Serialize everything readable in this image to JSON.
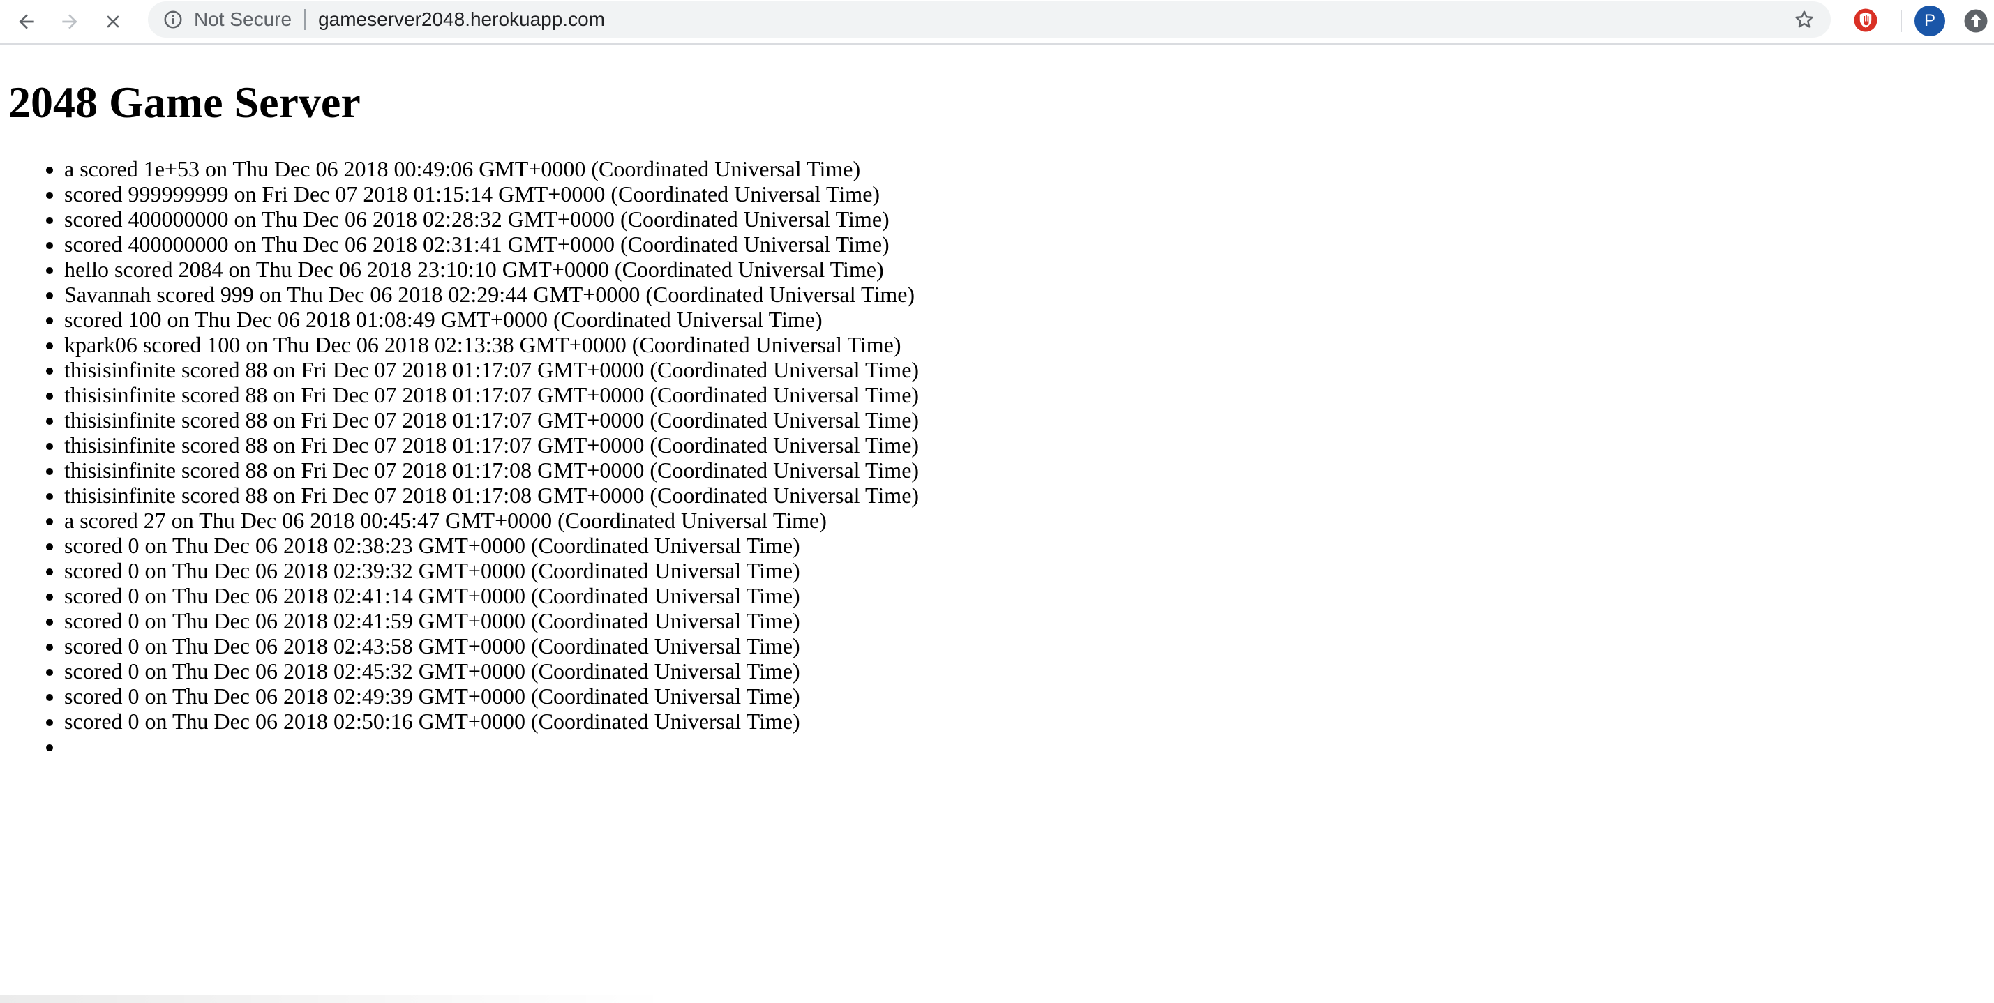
{
  "browser": {
    "security_label": "Not Secure",
    "url": "gameserver2048.herokuapp.com",
    "profile_initial": "P",
    "icons": {
      "back": "arrow-left-icon",
      "forward": "arrow-right-icon",
      "stop": "close-x-icon",
      "info": "info-circle-icon",
      "bookmark": "star-icon",
      "extension": "red-shield-extension-icon",
      "update": "up-arrow-circle-icon"
    },
    "colors": {
      "omnibox_bg": "#f1f3f4",
      "avatar_bg": "#1a56a8",
      "extension": "#d93025"
    }
  },
  "page": {
    "title": "2048 Game Server",
    "scores": [
      "a scored 1e+53 on Thu Dec 06 2018 00:49:06 GMT+0000 (Coordinated Universal Time)",
      "scored 999999999 on Fri Dec 07 2018 01:15:14 GMT+0000 (Coordinated Universal Time)",
      "scored 400000000 on Thu Dec 06 2018 02:28:32 GMT+0000 (Coordinated Universal Time)",
      "scored 400000000 on Thu Dec 06 2018 02:31:41 GMT+0000 (Coordinated Universal Time)",
      "hello scored 2084 on Thu Dec 06 2018 23:10:10 GMT+0000 (Coordinated Universal Time)",
      "Savannah scored 999 on Thu Dec 06 2018 02:29:44 GMT+0000 (Coordinated Universal Time)",
      "scored 100 on Thu Dec 06 2018 01:08:49 GMT+0000 (Coordinated Universal Time)",
      "kpark06 scored 100 on Thu Dec 06 2018 02:13:38 GMT+0000 (Coordinated Universal Time)",
      "thisisinfinite scored 88 on Fri Dec 07 2018 01:17:07 GMT+0000 (Coordinated Universal Time)",
      "thisisinfinite scored 88 on Fri Dec 07 2018 01:17:07 GMT+0000 (Coordinated Universal Time)",
      "thisisinfinite scored 88 on Fri Dec 07 2018 01:17:07 GMT+0000 (Coordinated Universal Time)",
      "thisisinfinite scored 88 on Fri Dec 07 2018 01:17:07 GMT+0000 (Coordinated Universal Time)",
      "thisisinfinite scored 88 on Fri Dec 07 2018 01:17:08 GMT+0000 (Coordinated Universal Time)",
      "thisisinfinite scored 88 on Fri Dec 07 2018 01:17:08 GMT+0000 (Coordinated Universal Time)",
      "a scored 27 on Thu Dec 06 2018 00:45:47 GMT+0000 (Coordinated Universal Time)",
      "scored 0 on Thu Dec 06 2018 02:38:23 GMT+0000 (Coordinated Universal Time)",
      "scored 0 on Thu Dec 06 2018 02:39:32 GMT+0000 (Coordinated Universal Time)",
      "scored 0 on Thu Dec 06 2018 02:41:14 GMT+0000 (Coordinated Universal Time)",
      "scored 0 on Thu Dec 06 2018 02:41:59 GMT+0000 (Coordinated Universal Time)",
      "scored 0 on Thu Dec 06 2018 02:43:58 GMT+0000 (Coordinated Universal Time)",
      "scored 0 on Thu Dec 06 2018 02:45:32 GMT+0000 (Coordinated Universal Time)",
      "scored 0 on Thu Dec 06 2018 02:49:39 GMT+0000 (Coordinated Universal Time)",
      "scored 0 on Thu Dec 06 2018 02:50:16 GMT+0000 (Coordinated Universal Time)",
      ""
    ]
  }
}
